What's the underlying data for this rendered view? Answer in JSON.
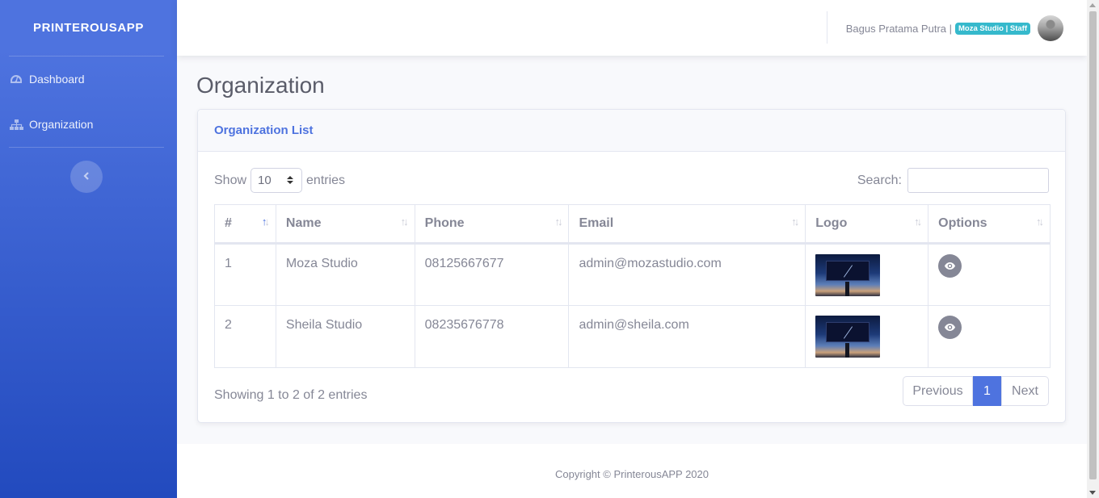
{
  "sidebar": {
    "brand": "PRINTEROUSAPP",
    "items": [
      {
        "label": "Dashboard",
        "icon": "tachometer-icon"
      },
      {
        "label": "Organization",
        "icon": "sitemap-icon"
      }
    ],
    "toggle_icon": "chevron-left-icon"
  },
  "topbar": {
    "user_name": "Bagus Pratama Putra |",
    "role_badge": "Moza Studio | Staff",
    "badge_color": "#36b9cc"
  },
  "page": {
    "title": "Organization"
  },
  "card": {
    "header": "Organization List",
    "length": {
      "show_label": "Show",
      "value": "10",
      "entries_label": "entries"
    },
    "search": {
      "label": "Search:",
      "value": "",
      "placeholder": ""
    },
    "columns": [
      "#",
      "Name",
      "Phone",
      "Email",
      "Logo",
      "Options"
    ],
    "rows": [
      {
        "no": "1",
        "name": "Moza Studio",
        "phone": "08125667677",
        "email": "admin@mozastudio.com"
      },
      {
        "no": "2",
        "name": "Sheila Studio",
        "phone": "08235676778",
        "email": "admin@sheila.com"
      }
    ],
    "info": "Showing 1 to 2 of 2 entries",
    "pagination": {
      "previous": "Previous",
      "current": "1",
      "next": "Next"
    }
  },
  "footer": {
    "copyright": "Copyright © PrinterousAPP 2020"
  },
  "colors": {
    "primary": "#4e73df",
    "sidebar_end": "#224abe",
    "text": "#858796"
  }
}
